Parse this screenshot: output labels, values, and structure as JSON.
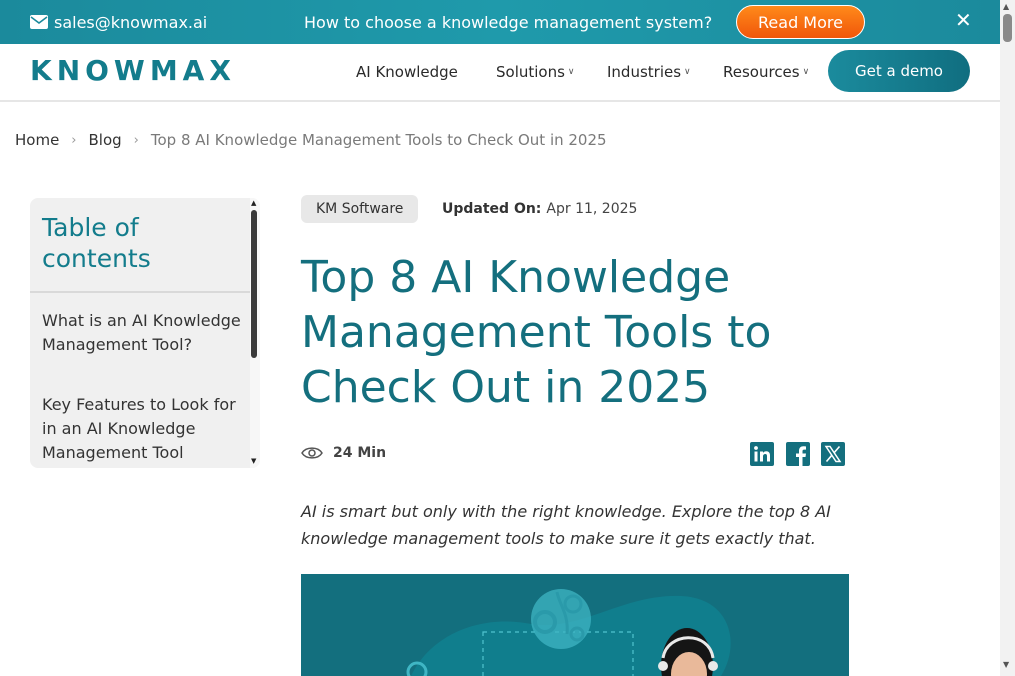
{
  "topbar": {
    "email": "sales@knowmax.ai",
    "promo": "How to choose a knowledge management system?",
    "read_more": "Read More",
    "close": "✕"
  },
  "header": {
    "logo": "KNOWMAX",
    "nav": [
      {
        "label": "AI Knowledge",
        "dropdown": false
      },
      {
        "label": "Solutions",
        "dropdown": true
      },
      {
        "label": "Industries",
        "dropdown": true
      },
      {
        "label": "Resources",
        "dropdown": true
      }
    ],
    "demo": "Get a demo"
  },
  "breadcrumb": {
    "home": "Home",
    "blog": "Blog",
    "current": "Top 8 AI Knowledge Management Tools to Check Out in 2025"
  },
  "toc": {
    "title": "Table of contents",
    "items": [
      "What is an AI Knowledge Management Tool?",
      "Key Features to Look for in an AI Knowledge Management Tool"
    ]
  },
  "article": {
    "tag": "KM Software",
    "updated_label": "Updated On:",
    "updated_date": "Apr 11, 2025",
    "title": "Top 8 AI Knowledge Management Tools to Check Out in 2025",
    "read_time": "24 Min",
    "intro": "AI is smart but only with the right knowledge. Explore the top 8 AI knowledge management tools to make sure it gets exactly that."
  },
  "icons": {
    "email": "envelope-icon",
    "eye": "eye-icon",
    "share": [
      "linkedin-icon",
      "facebook-icon",
      "x-twitter-icon"
    ]
  },
  "colors": {
    "brand_teal": "#137c8c",
    "topbar": "#1b8a9c",
    "accent_orange": "#f0560a"
  }
}
